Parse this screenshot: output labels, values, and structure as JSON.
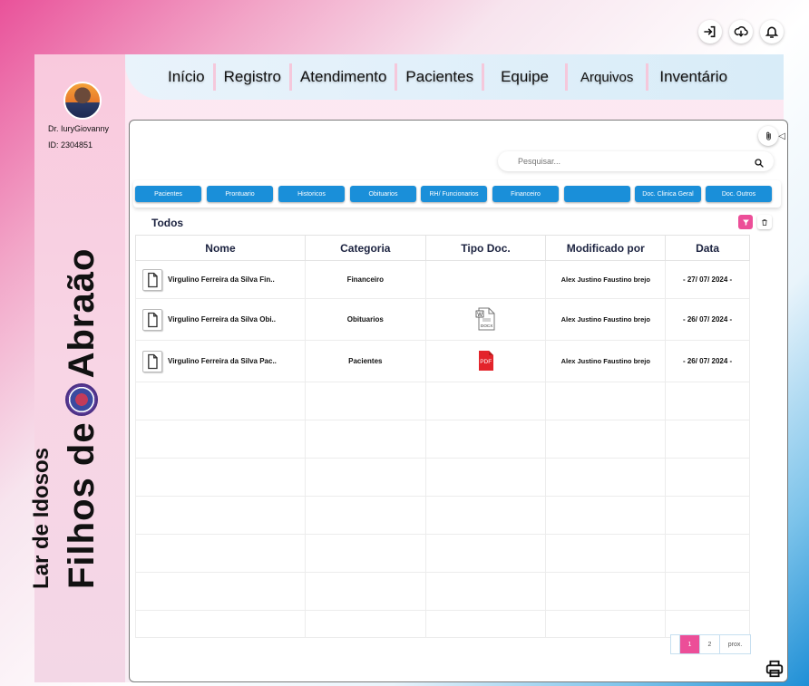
{
  "user": {
    "name": "Dr. IuryGiovanny",
    "id": "ID: 2304851"
  },
  "brand": {
    "line1": "Lar de Idosos",
    "line2": "Filhos de",
    "line3": "Abraão"
  },
  "nav": [
    "Início",
    "Registro",
    "Atendimento",
    "Pacientes",
    "Equipe",
    "Arquivos",
    "Inventário"
  ],
  "search": {
    "placeholder": "Pesquisar..."
  },
  "categories": [
    "Pacientes",
    "Prontuario",
    "Historicos",
    "Obituarios",
    "RH/ Funcionarios",
    "Financeiro",
    "",
    "Doc. Clinica Geral",
    "Doc. Outros"
  ],
  "filter_label": "Todos",
  "table": {
    "headers": [
      "Nome",
      "Categoria",
      "Tipo Doc.",
      "Modificado por",
      "Data"
    ],
    "rows": [
      {
        "name": "Virgulino Ferreira da Silva Fin..",
        "category": "Financeiro",
        "type": "",
        "modified_by": "Alex Justino Faustino brejo",
        "date": "- 27/ 07/ 2024 -"
      },
      {
        "name": "Virgulino Ferreira da Silva Obi..",
        "category": "Obituarios",
        "type": "DOCX",
        "modified_by": "Alex Justino Faustino brejo",
        "date": "- 26/ 07/ 2024 -"
      },
      {
        "name": "Virgulino Ferreira da Silva Pac..",
        "category": "Pacientes",
        "type": "PDF",
        "modified_by": "Alex Justino Faustino brejo",
        "date": "- 26/ 07/ 2024 -"
      }
    ]
  },
  "pagination": {
    "pages": [
      "1",
      "2"
    ],
    "next": "prox."
  },
  "colors": {
    "accent_pink": "#ec4e98",
    "button_blue": "#1a8fd9"
  },
  "icons": [
    "login-icon",
    "cloud-download-icon",
    "bell-icon",
    "paperclip-icon",
    "search-icon",
    "filter-icon",
    "trash-icon",
    "file-icon",
    "docx-icon",
    "pdf-icon",
    "printer-icon"
  ]
}
